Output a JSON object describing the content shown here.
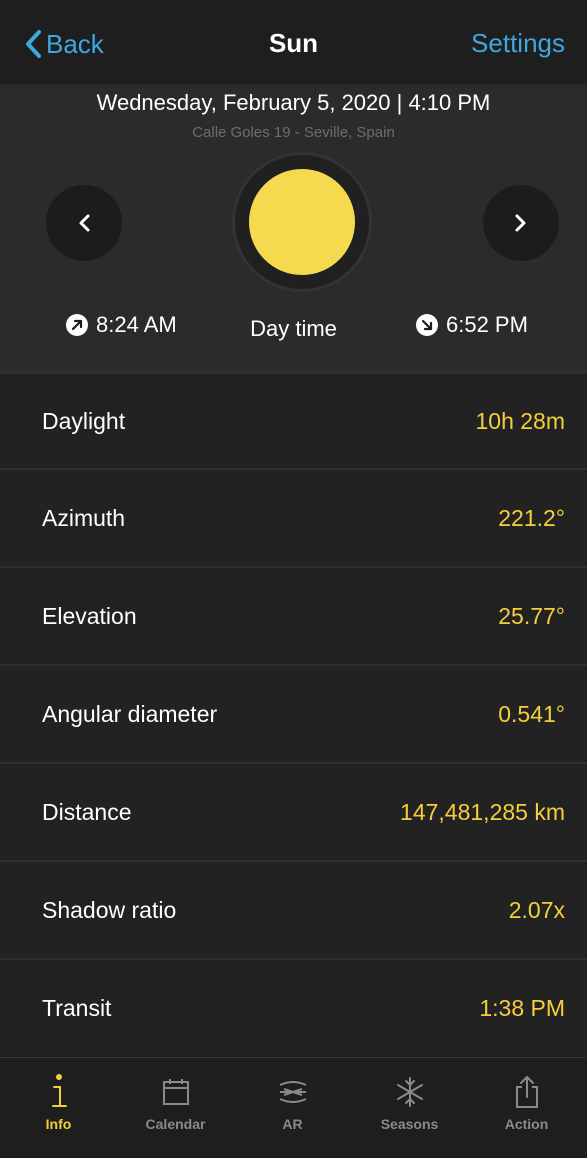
{
  "nav": {
    "back_label": "Back",
    "title": "Sun",
    "settings_label": "Settings"
  },
  "header": {
    "date_time": "Wednesday, February 5, 2020 | 4:10 PM",
    "address": "Calle Goles 19 - Seville, Spain",
    "prev_icon": "chevron-left-icon",
    "next_icon": "chevron-right-icon",
    "sunrise": "8:24 AM",
    "phase": "Day time",
    "sunset": "6:52 PM"
  },
  "rows": [
    {
      "label": "Daylight",
      "value": "10h 28m"
    },
    {
      "label": "Azimuth",
      "value": "221.2°"
    },
    {
      "label": "Elevation",
      "value": "25.77°"
    },
    {
      "label": "Angular diameter",
      "value": "0.541°"
    },
    {
      "label": "Distance",
      "value": "147,481,285 km"
    },
    {
      "label": "Shadow ratio",
      "value": "2.07x"
    },
    {
      "label": "Transit",
      "value": "1:38 PM"
    }
  ],
  "tabs": [
    {
      "label": "Info",
      "icon": "info-icon",
      "active": true
    },
    {
      "label": "Calendar",
      "icon": "calendar-icon",
      "active": false
    },
    {
      "label": "AR",
      "icon": "ar-icon",
      "active": false
    },
    {
      "label": "Seasons",
      "icon": "snowflake-icon",
      "active": false
    },
    {
      "label": "Action",
      "icon": "share-icon",
      "active": false
    }
  ],
  "colors": {
    "accent_blue": "#3fa7e0",
    "accent_yellow": "#f5cf3a",
    "sun": "#f5d94e"
  }
}
